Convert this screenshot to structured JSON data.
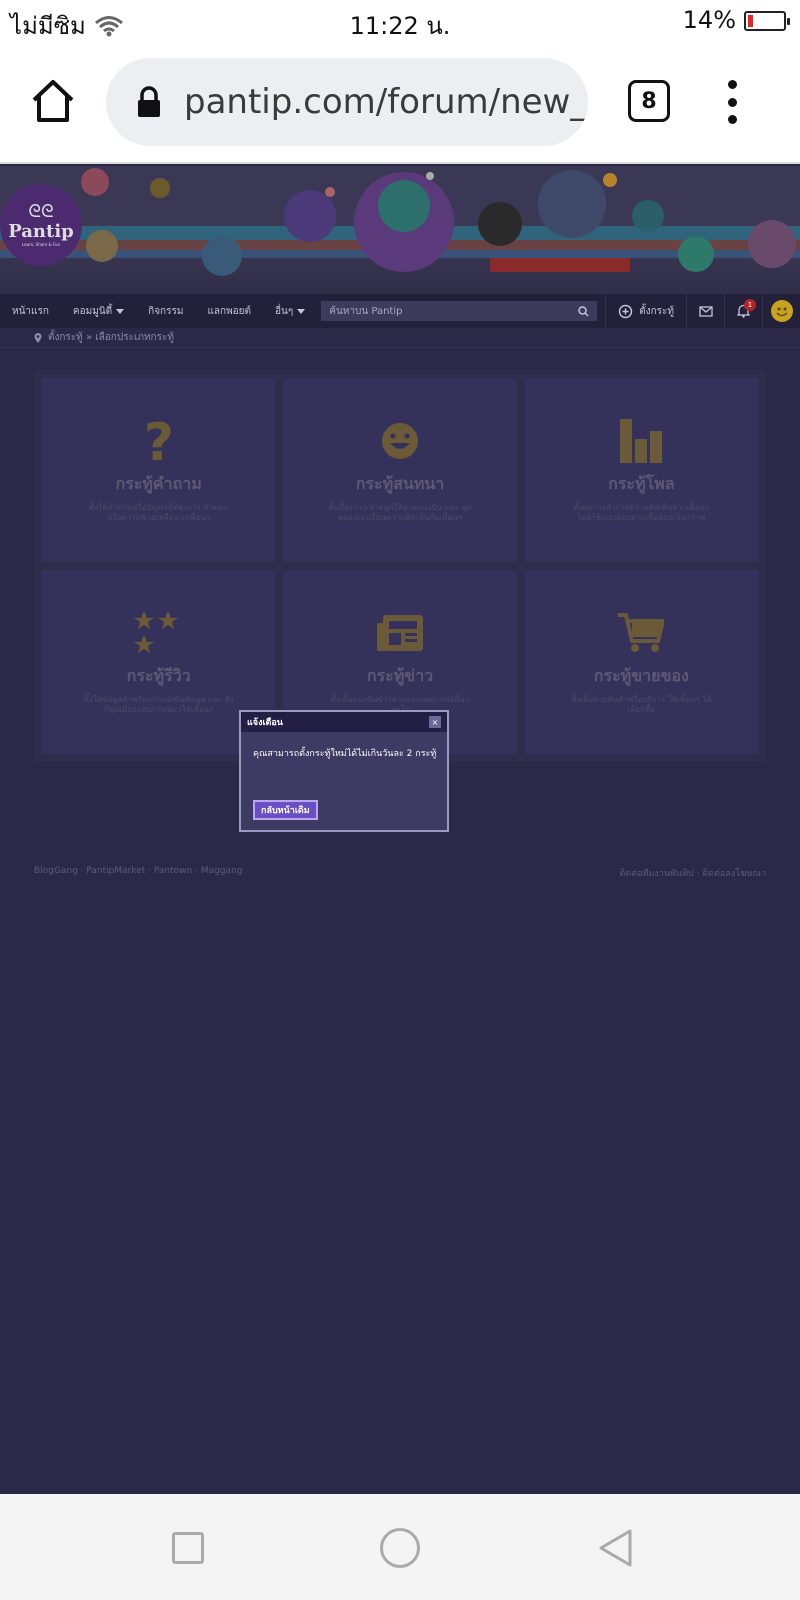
{
  "status_bar": {
    "carrier": "ไม่มีซิม",
    "time": "11:22 น.",
    "battery": "14%",
    "battery_level": 0.14
  },
  "browser": {
    "url": "pantip.com/forum/new_",
    "tab_count": "8"
  },
  "banner": {
    "logo_text": "Pantip",
    "logo_tagline": "Learn, Share & Fun"
  },
  "nav": {
    "items": [
      "หน้าแรก",
      "คอมมูนิตี้",
      "กิจกรรม",
      "แลกพอยต์",
      "อื่นๆ"
    ],
    "search_placeholder": "ค้นหาบน Pantip",
    "create_label": "ตั้งกระทู้",
    "notification_count": "1"
  },
  "breadcrumb": {
    "text": "ตั้งกระทู้ » เลือกประเภทกระทู้"
  },
  "cards": [
    {
      "title": "กระทู้คำถาม",
      "desc": "ตั้งได้คำถามหรือปัญหาที่ต้องการ คำตอบหรือความช่วยเหลือจากเพื่อนๆ",
      "icon": "question-icon"
    },
    {
      "title": "กระทู้สนทนา",
      "desc": "ตั้งเรื่องราวเล่าสนุกให้อ่านแบ่งปัน และ พูดคุยแลกเปลี่ยนความคิดเห็นกับเพื่อนๆ",
      "icon": "smile-icon"
    },
    {
      "title": "กระทู้โพล",
      "desc": "ตั้งผลการสำรวจความคิดเห็นจากเพื่อนๆ โดยใช้แบบสอบถามเพื่อสรุปเป็นกราฟ",
      "icon": "bar-chart-icon"
    },
    {
      "title": "กระทู้รีวิว",
      "desc": "ตั้งให้ข้อมูลสำหรับการแบ่งปันข้อมูล และ สิ่งที่คุณมีประสบการณ์มาให้เพื่อนๆ",
      "icon": "star-rating-icon"
    },
    {
      "title": "กระทู้ข่าว",
      "desc": "ตั้งเพื่อแบ่งปันข่าวสารและเหตุการณ์ที่น่าสนใจ",
      "icon": "newspaper-icon"
    },
    {
      "title": "กระทู้ขายของ",
      "desc": "ตั้งเพื่อขายสินค้าหรือบริการ ให้เพื่อนๆ ได้เลือกซื้อ",
      "icon": "shopping-cart-icon"
    }
  ],
  "footer": {
    "left": "BlogGang · PantipMarket · Pantown · Maggang",
    "right": "ติดต่อทีมงานพันทิป · ติดต่อลงโฆษณา"
  },
  "dialog": {
    "title": "แจ้งเตือน",
    "close": "×",
    "message": "คุณสามารถตั้งกระทู้ใหม่ได้ไม่เกินวันละ 2 กระทู้",
    "button": "กลับหน้าเดิม"
  },
  "colors": {
    "page_bg": "#2b2947",
    "dialog_bg": "#3d3a64",
    "button": "#6a4fc4",
    "badge": "#b2262a"
  }
}
